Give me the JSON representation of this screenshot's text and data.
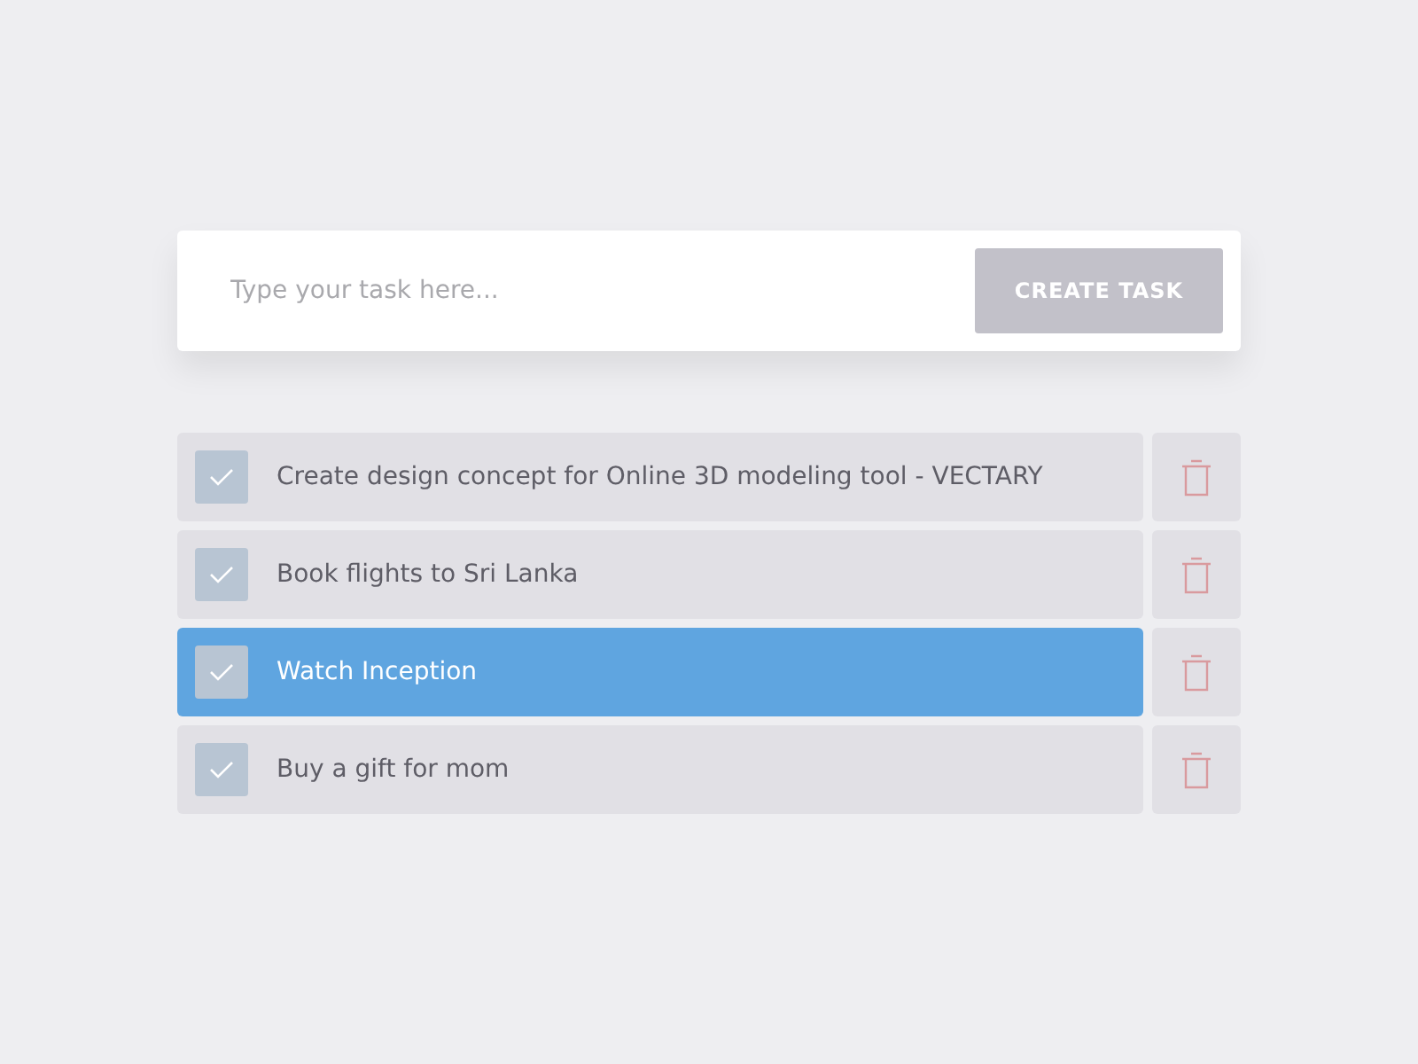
{
  "new_task": {
    "placeholder": "Type your task here...",
    "button": "CREATE TASK"
  },
  "tasks": [
    {
      "title": "Create design concept for Online 3D modeling tool - VECTARY",
      "selected": false
    },
    {
      "title": "Book flights to Sri Lanka",
      "selected": false
    },
    {
      "title": "Watch Inception",
      "selected": true
    },
    {
      "title": "Buy a gift for mom",
      "selected": false
    }
  ]
}
